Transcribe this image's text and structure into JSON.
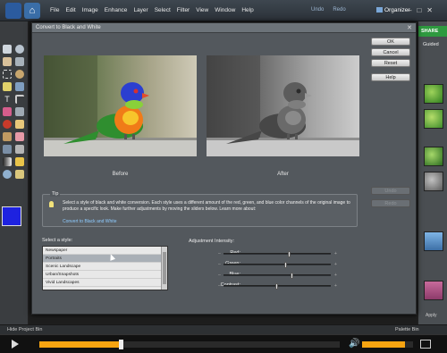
{
  "menubar": {
    "menus": [
      "File",
      "Edit",
      "Image",
      "Enhance",
      "Layer",
      "Select",
      "Filter",
      "View",
      "Window",
      "Help"
    ],
    "undo": "Undo",
    "redo": "Redo",
    "organizer": "Organizer",
    "window_controls": [
      "–",
      "□",
      "✕"
    ]
  },
  "right_panel": {
    "share_tab": "SHARE",
    "guided_tab": "Guided",
    "apply_label": "Apply"
  },
  "dialog": {
    "title": "Convert to Black and White",
    "close": "✕",
    "buttons": {
      "ok": "OK",
      "cancel": "Cancel",
      "reset": "Reset",
      "help": "Help",
      "undo": "Undo",
      "redo": "Redo"
    },
    "before_caption": "Before",
    "after_caption": "After",
    "tip": {
      "label": "Tip",
      "text": "Select a style of black and white conversion. Each style uses a different amount of the red, green, and blue color channels of the original image to produce a specific look. Make further adjustments by moving the sliders below. Learn more about:",
      "link": "Convert to Black and White"
    },
    "style_label": "Select a style:",
    "styles": [
      "Newspaper",
      "Portraits",
      "Scenic Landscape",
      "Urban/Snapshots",
      "Vivid Landscapes"
    ],
    "selected_style_index": 1,
    "adjustment_label": "Adjustment Intensity:",
    "sliders": [
      {
        "name": "Red:",
        "value": 0.62
      },
      {
        "name": "Green:",
        "value": 0.58
      },
      {
        "name": "Blue:",
        "value": 0.64
      },
      {
        "name": "Contrast:",
        "value": 0.5
      }
    ]
  },
  "bottom_bar": {
    "hide_bin": "Hide Project Bin",
    "palette_bin": "Palette Bin"
  },
  "player": {
    "progress": 0.27,
    "volume": 0.85
  },
  "colors": {
    "foreground": "#1e22e0",
    "background": "#ffffff",
    "accent": "#f7a411",
    "share_green": "#2e9a3f"
  }
}
